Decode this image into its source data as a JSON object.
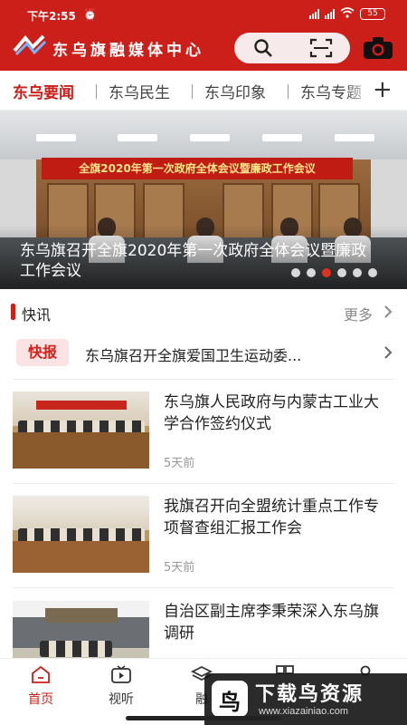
{
  "status_bar": {
    "time": "下午2:55",
    "battery": "55"
  },
  "header": {
    "brand": "东乌旗融媒体中心",
    "icons": [
      "search-icon",
      "scan-icon",
      "camera-icon"
    ]
  },
  "tabs": {
    "items": [
      "东乌要闻",
      "东乌民生",
      "东乌印象",
      "东乌专题"
    ],
    "active": 0
  },
  "banner": {
    "sign_text": "全旗2020年第一次政府全体会议暨廉政工作会议",
    "caption": "东乌旗召开全旗2020年第一次政府全体会议暨廉政工作会议",
    "dot_count": 6,
    "active_dot": 2
  },
  "section": {
    "title": "快讯",
    "more": "更多"
  },
  "flash": {
    "badge": "快报",
    "text": "东乌旗召开全旗爱国卫生运动委..."
  },
  "news": [
    {
      "title": "东乌旗人民政府与内蒙古工业大学合作签约仪式",
      "time": "5天前"
    },
    {
      "title": "我旗召开向全盟统计重点工作专项督查组汇报工作会",
      "time": "5天前"
    },
    {
      "title": "自治区副主席李秉荣深入东乌旗调研",
      "time": ""
    }
  ],
  "bottom_nav": {
    "items": [
      "首页",
      "视听",
      "融",
      "",
      ""
    ],
    "active": 0
  },
  "watermark": {
    "logo_char": "鸟",
    "text": "下载鸟资源",
    "url": "www.xiazainiao.com"
  },
  "colors": {
    "brand_red": "#cd1f1a",
    "active_dot": "#e0301e"
  }
}
